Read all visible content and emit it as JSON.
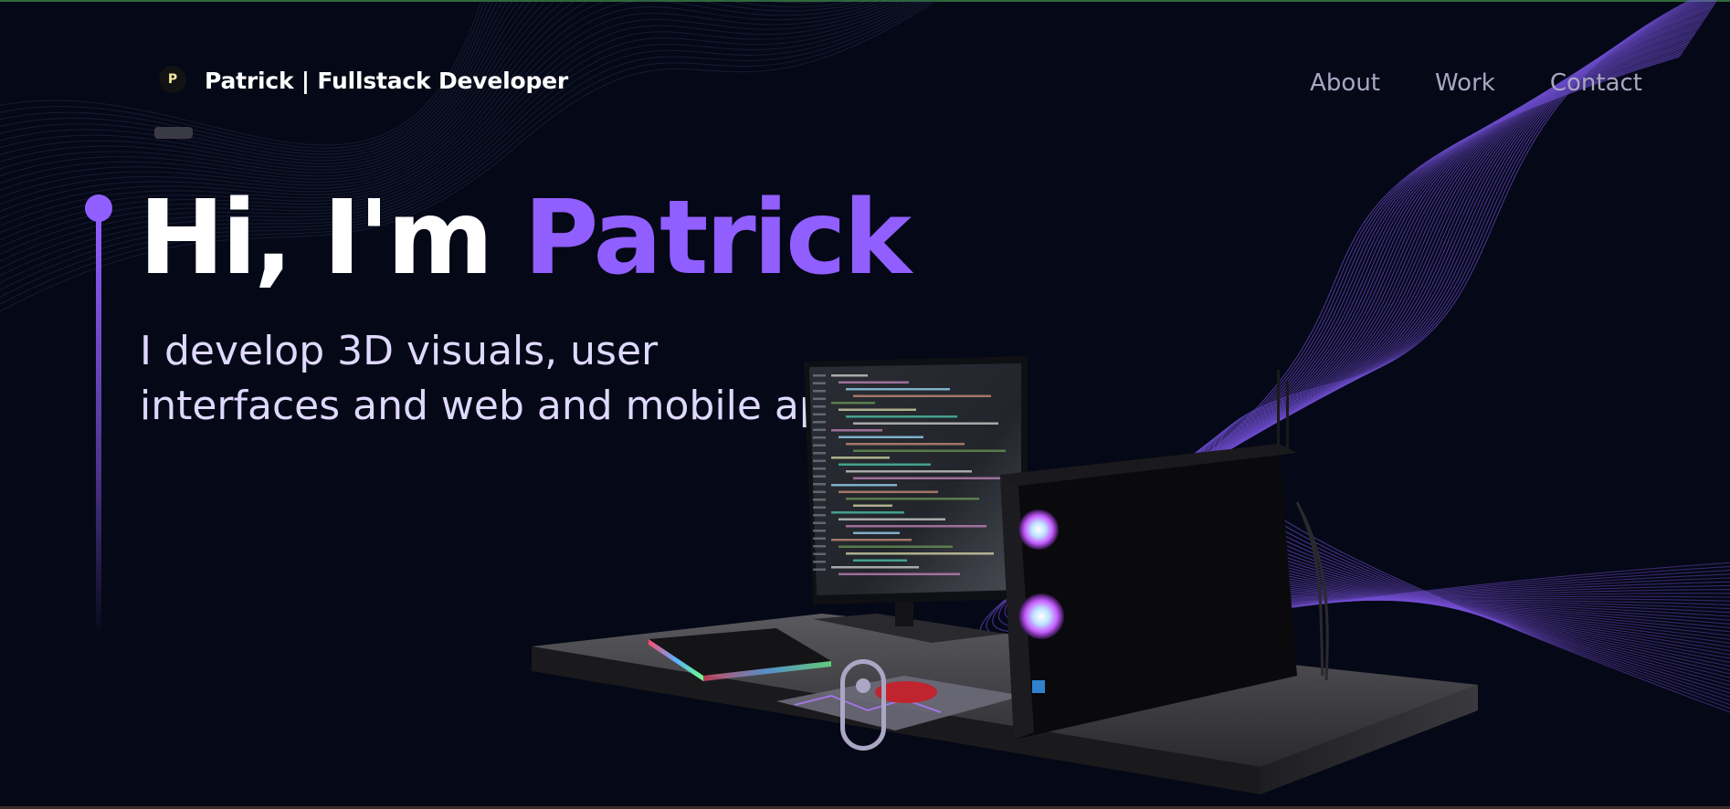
{
  "header": {
    "logo_letter": "P",
    "brand": "Patrick  | Fullstack Developer"
  },
  "nav": {
    "items": [
      {
        "label": "About"
      },
      {
        "label": "Work"
      },
      {
        "label": "Contact"
      }
    ]
  },
  "hero": {
    "greeting": "Hi, I'm ",
    "name": "Patrick",
    "subtitle_line1": "I develop 3D visuals, user",
    "subtitle_line2": "interfaces and web and mobile applications"
  },
  "colors": {
    "background": "#050816",
    "accent": "#915eff",
    "nav_text": "#aaa6c3",
    "white": "#ffffff"
  },
  "icons": [
    "logo-icon",
    "scroll-indicator-icon"
  ]
}
